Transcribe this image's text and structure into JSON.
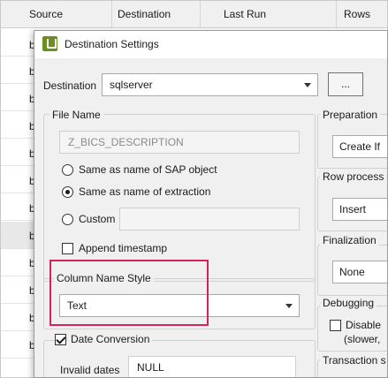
{
  "table": {
    "columns": [
      "Source",
      "Destination",
      "Last Run",
      "Rows"
    ],
    "row_letters": [
      "b",
      "b",
      "b",
      "b",
      "b",
      "b",
      "b",
      "b",
      "b",
      "b",
      "b",
      "b"
    ]
  },
  "dialog": {
    "title": "Destination Settings",
    "destination_label": "Destination",
    "destination_value": "sqlserver",
    "browse_label": "...",
    "file_name": {
      "title": "File Name",
      "placeholder": "Z_BICS_DESCRIPTION",
      "options": [
        {
          "label": "Same as name of SAP object",
          "selected": false
        },
        {
          "label": "Same as name of extraction",
          "selected": true
        },
        {
          "label": "Custom",
          "selected": false
        }
      ],
      "append_timestamp_label": "Append timestamp",
      "append_timestamp_checked": false
    },
    "column_name_style": {
      "title": "Column Name Style",
      "value": "Text"
    },
    "date_conversion": {
      "label": "Date Conversion",
      "checked": true,
      "invalid_dates_label": "Invalid dates",
      "invalid_dates_value": "NULL"
    },
    "right_panel": {
      "preparation_title": "Preparation",
      "preparation_value": "Create If",
      "row_processing_title": "Row process",
      "row_processing_value": "Insert",
      "finalization_title": "Finalization",
      "finalization_value": "None",
      "debugging_title": "Debugging",
      "disable_label": "Disable",
      "disable_note": "(slower,",
      "transaction_title": "Transaction s"
    },
    "highlight_color": "#d6245b"
  }
}
